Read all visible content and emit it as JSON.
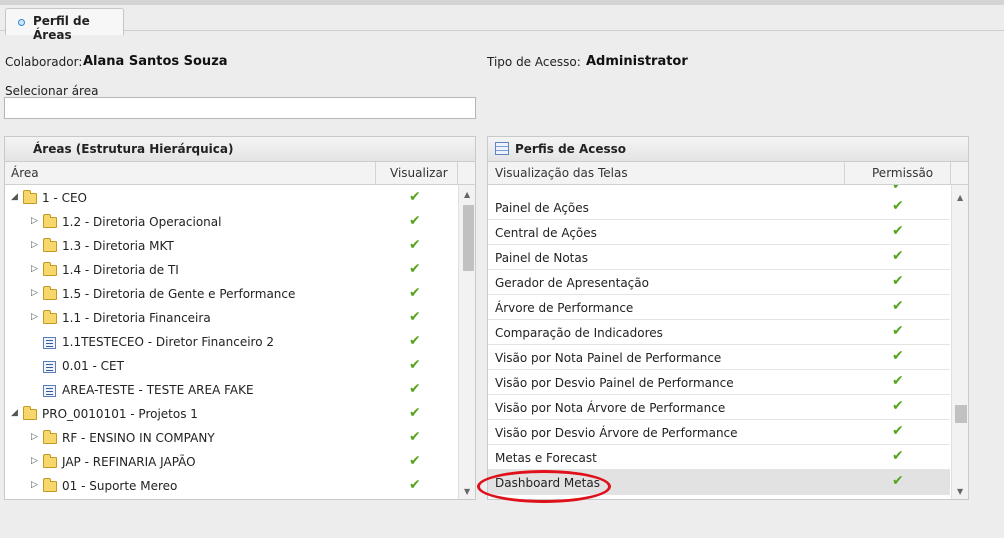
{
  "tab": {
    "label": "Perfil de Áreas"
  },
  "fields": {
    "colaborador_label": "Colaborador:",
    "colaborador_value": "Alana Santos Souza",
    "tipo_label": "Tipo de Acesso:",
    "tipo_value": "Administrator",
    "selecionar_label": "Selecionar área",
    "selecionar_value": ""
  },
  "areas_panel": {
    "title": "Áreas (Estrutura Hierárquica)",
    "col_area": "Área",
    "col_visualizar": "Visualizar",
    "rows": [
      {
        "label": "1 - CEO",
        "icon": "folder-open-icon",
        "arrow": "expanded"
      },
      {
        "label": "1.2 - Diretoria Operacional",
        "icon": "folder-icon",
        "arrow": "collapsed"
      },
      {
        "label": "1.3 - Diretoria MKT",
        "icon": "folder-icon",
        "arrow": "collapsed"
      },
      {
        "label": "1.4 - Diretoria de TI",
        "icon": "folder-icon",
        "arrow": "collapsed"
      },
      {
        "label": "1.5 - Diretoria de Gente e Performance",
        "icon": "folder-icon",
        "arrow": "collapsed"
      },
      {
        "label": "1.1 - Diretoria Financeira",
        "icon": "folder-icon",
        "arrow": "collapsed"
      },
      {
        "label": "1.1TESTECEO - Diretor Financeiro 2",
        "icon": "document-icon",
        "arrow": "none"
      },
      {
        "label": "0.01 - CET",
        "icon": "document-icon",
        "arrow": "none"
      },
      {
        "label": "AREA-TESTE - TESTE AREA FAKE",
        "icon": "document-icon",
        "arrow": "none"
      },
      {
        "label": "PRO_0010101 - Projetos 1",
        "icon": "folder-open-icon",
        "arrow": "expanded"
      },
      {
        "label": "RF - ENSINO IN COMPANY",
        "icon": "folder-icon",
        "arrow": "collapsed"
      },
      {
        "label": "JAP - REFINARIA JAPÃO",
        "icon": "folder-icon",
        "arrow": "collapsed"
      },
      {
        "label": "01 - Suporte Mereo",
        "icon": "folder-icon",
        "arrow": "collapsed"
      }
    ]
  },
  "perfis_panel": {
    "title": "Perfis de Acesso",
    "col_telas": "Visualização das Telas",
    "col_permissao": "Permissão",
    "rows": [
      {
        "label": "Painel de Ações"
      },
      {
        "label": "Central de Ações"
      },
      {
        "label": "Painel de Notas"
      },
      {
        "label": "Gerador de Apresentação"
      },
      {
        "label": "Árvore de Performance"
      },
      {
        "label": "Comparação de Indicadores"
      },
      {
        "label": "Visão por Nota Painel de Performance"
      },
      {
        "label": "Visão por Desvio Painel de Performance"
      },
      {
        "label": "Visão por Nota Árvore de Performance"
      },
      {
        "label": "Visão por Desvio Árvore de Performance"
      },
      {
        "label": "Metas e Forecast"
      },
      {
        "label": "Dashboard Metas"
      }
    ],
    "selected_row": "Dashboard Metas"
  },
  "colors": {
    "check": "#55a51f",
    "highlight": "#e0101b",
    "tab_dot": "#2f8ad7"
  }
}
